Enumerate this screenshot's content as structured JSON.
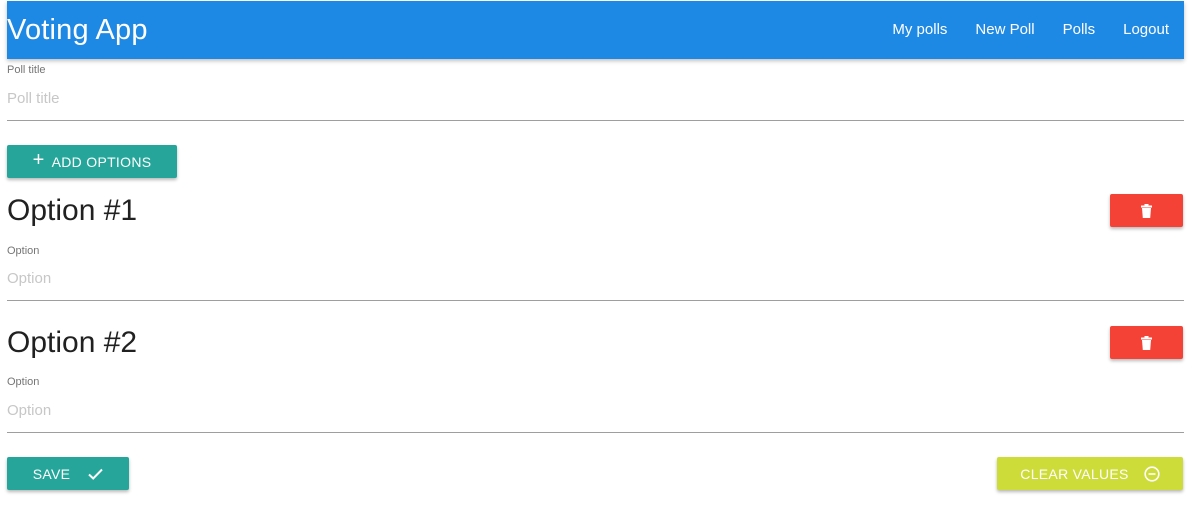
{
  "navbar": {
    "brand": "Voting App",
    "links": [
      "My polls",
      "New Poll",
      "Polls",
      "Logout"
    ],
    "color": "#1e88e5"
  },
  "poll": {
    "title_label": "Poll title",
    "title_placeholder": "Poll title",
    "title_value": ""
  },
  "add_options": {
    "label": "ADD OPTIONS",
    "icon": "plus-icon"
  },
  "options": [
    {
      "heading": "Option #1",
      "field_label": "Option",
      "placeholder": "Option",
      "value": "",
      "delete_icon": "trash-icon"
    },
    {
      "heading": "Option #2",
      "field_label": "Option",
      "placeholder": "Option",
      "value": "",
      "delete_icon": "trash-icon"
    }
  ],
  "actions": {
    "save_label": "SAVE",
    "save_icon": "check-icon",
    "clear_label": "CLEAR VALUES",
    "clear_icon": "minus-circle-icon"
  },
  "colors": {
    "primary": "#1e88e5",
    "teal": "#26a69a",
    "danger": "#f44336",
    "lime": "#cddc39"
  }
}
